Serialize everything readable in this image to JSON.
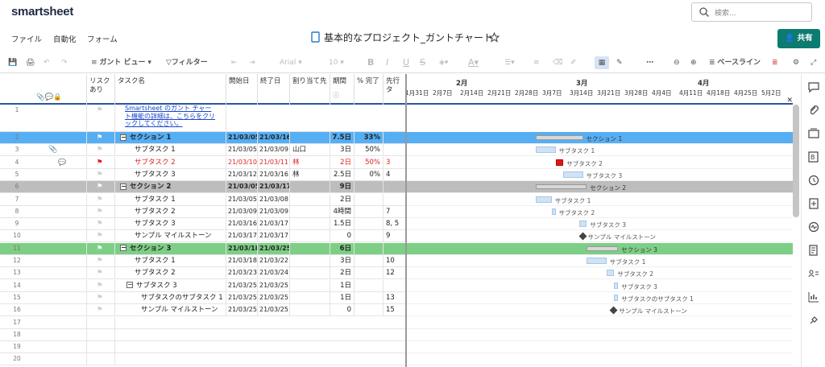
{
  "app": {
    "brand": "smartsheet",
    "search_placeholder": "検索..."
  },
  "menus": [
    "ファイル",
    "自動化",
    "フォーム"
  ],
  "doc_title": "基本的なプロジェクト_ガントチャート",
  "share_label": "共有",
  "toolbar": {
    "gantt_view": "ガント ビュー",
    "filter": "フィルター",
    "font": "Arial",
    "size": "10",
    "baseline": "ベースライン"
  },
  "columns": {
    "risk": "リスク\nあり",
    "task": "タスク名",
    "start": "開始日",
    "end": "終了日",
    "assign": "割り当て先",
    "duration": "期間",
    "pct": "% 完了",
    "pred": "先行タ"
  },
  "months": [
    "2月",
    "3月",
    "4月"
  ],
  "weeks": [
    "1月31日",
    "2月7日",
    "2月14日",
    "2月21日",
    "2月28日",
    "3月7日",
    "3月14日",
    "3月21日",
    "3月28日",
    "4月4日",
    "4月11日",
    "4月18日",
    "4月25日",
    "5月2日"
  ],
  "info_link": "Smartsheet のガント チャート機能の詳細は、こちらをクリックしてください。",
  "rows": [
    {
      "n": "2",
      "type": "section",
      "color": "#56aef3",
      "task": "セクション 1",
      "start": "21/03/05",
      "end": "21/03/16",
      "assign": "",
      "dur": "7.5日",
      "pct": "33%",
      "pred": "",
      "glabel": "セクション 1"
    },
    {
      "n": "3",
      "type": "task",
      "task": "サブタスク 1",
      "start": "21/03/05",
      "end": "21/03/09",
      "assign": "山口",
      "dur": "3日",
      "pct": "50%",
      "pred": "",
      "glabel": "サブタスク 1",
      "attach": true
    },
    {
      "n": "4",
      "type": "task",
      "red": true,
      "task": "サブタスク 2",
      "start": "21/03/10",
      "end": "21/03/11",
      "assign": "林",
      "dur": "2日",
      "pct": "50%",
      "pred": "3",
      "glabel": "サブタスク 2",
      "comment": true
    },
    {
      "n": "5",
      "type": "task",
      "task": "サブタスク 3",
      "start": "21/03/12",
      "end": "21/03/16",
      "assign": "林",
      "dur": "2.5日",
      "pct": "0%",
      "pred": "4",
      "glabel": "サブタスク 3"
    },
    {
      "n": "6",
      "type": "section",
      "color": "#bdbdbd",
      "task": "セクション 2",
      "start": "21/03/05",
      "end": "21/03/17",
      "assign": "",
      "dur": "9日",
      "pct": "",
      "pred": "",
      "glabel": "セクション 2"
    },
    {
      "n": "7",
      "type": "task",
      "task": "サブタスク 1",
      "start": "21/03/05",
      "end": "21/03/08",
      "assign": "",
      "dur": "2日",
      "pct": "",
      "pred": "",
      "glabel": "サブタスク 1"
    },
    {
      "n": "8",
      "type": "task",
      "task": "サブタスク 2",
      "start": "21/03/09",
      "end": "21/03/09",
      "assign": "",
      "dur": "4時間",
      "pct": "",
      "pred": "7",
      "glabel": "サブタスク 2"
    },
    {
      "n": "9",
      "type": "task",
      "task": "サブタスク 3",
      "start": "21/03/16",
      "end": "21/03/17",
      "assign": "",
      "dur": "1.5日",
      "pct": "",
      "pred": "8, 5",
      "glabel": "サブタスク 3"
    },
    {
      "n": "10",
      "type": "task",
      "task": "サンプル マイルストーン",
      "start": "21/03/17",
      "end": "21/03/17",
      "assign": "",
      "dur": "0",
      "pct": "",
      "pred": "9",
      "glabel": "サンプル マイルストーン",
      "milestone": true
    },
    {
      "n": "11",
      "type": "section",
      "color": "#7dcf85",
      "task": "セクション 3",
      "start": "21/03/18",
      "end": "21/03/25",
      "assign": "",
      "dur": "6日",
      "pct": "",
      "pred": "",
      "glabel": "セクション 3"
    },
    {
      "n": "12",
      "type": "task",
      "task": "サブタスク 1",
      "start": "21/03/18",
      "end": "21/03/22",
      "assign": "",
      "dur": "3日",
      "pct": "",
      "pred": "10",
      "glabel": "サブタスク 1"
    },
    {
      "n": "13",
      "type": "task",
      "task": "サブタスク 2",
      "start": "21/03/23",
      "end": "21/03/24",
      "assign": "",
      "dur": "2日",
      "pct": "",
      "pred": "12",
      "glabel": "サブタスク 2"
    },
    {
      "n": "14",
      "type": "task",
      "task": "サブタスク 3",
      "start": "21/03/25",
      "end": "21/03/25",
      "assign": "",
      "dur": "1日",
      "pct": "",
      "pred": "",
      "glabel": "サブタスク 3",
      "collapse": true
    },
    {
      "n": "15",
      "type": "task",
      "sub": true,
      "task": "サブタスクのサブタスク 1",
      "start": "21/03/25",
      "end": "21/03/25",
      "assign": "",
      "dur": "1日",
      "pct": "",
      "pred": "13",
      "glabel": "サブタスクのサブタスク 1"
    },
    {
      "n": "16",
      "type": "task",
      "sub": true,
      "task": "サンプル マイルストーン",
      "start": "21/03/25",
      "end": "21/03/25",
      "assign": "",
      "dur": "0",
      "pct": "",
      "pred": "15",
      "glabel": "サンプル マイルストーン",
      "milestone": true
    },
    {
      "n": "17",
      "type": "empty"
    },
    {
      "n": "18",
      "type": "empty"
    },
    {
      "n": "19",
      "type": "empty"
    },
    {
      "n": "20",
      "type": "empty"
    }
  ]
}
